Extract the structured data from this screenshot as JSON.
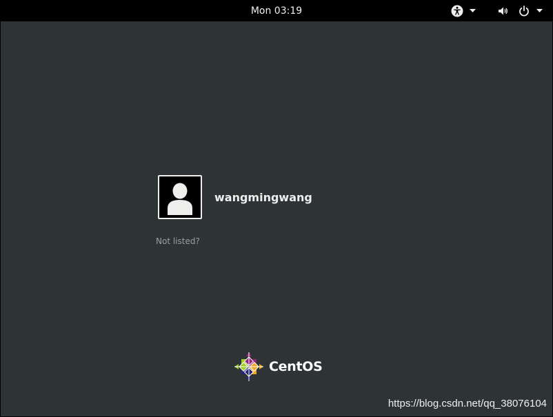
{
  "top_bar": {
    "clock": "Mon 03:19",
    "icons": [
      "accessibility-icon",
      "volume-icon",
      "power-icon"
    ]
  },
  "login": {
    "users": [
      {
        "name": "wangmingwang",
        "avatar_icon": "user-silhouette-icon"
      }
    ],
    "not_listed_label": "Not listed?"
  },
  "branding": {
    "logo_icon": "centos-logo",
    "name": "CentOS"
  },
  "watermark": "https://blog.csdn.net/qq_38076104",
  "colors": {
    "background": "#2e3436",
    "top_bar": "#000000",
    "text": "#eeeeec",
    "muted_text": "#9a9fa0"
  }
}
